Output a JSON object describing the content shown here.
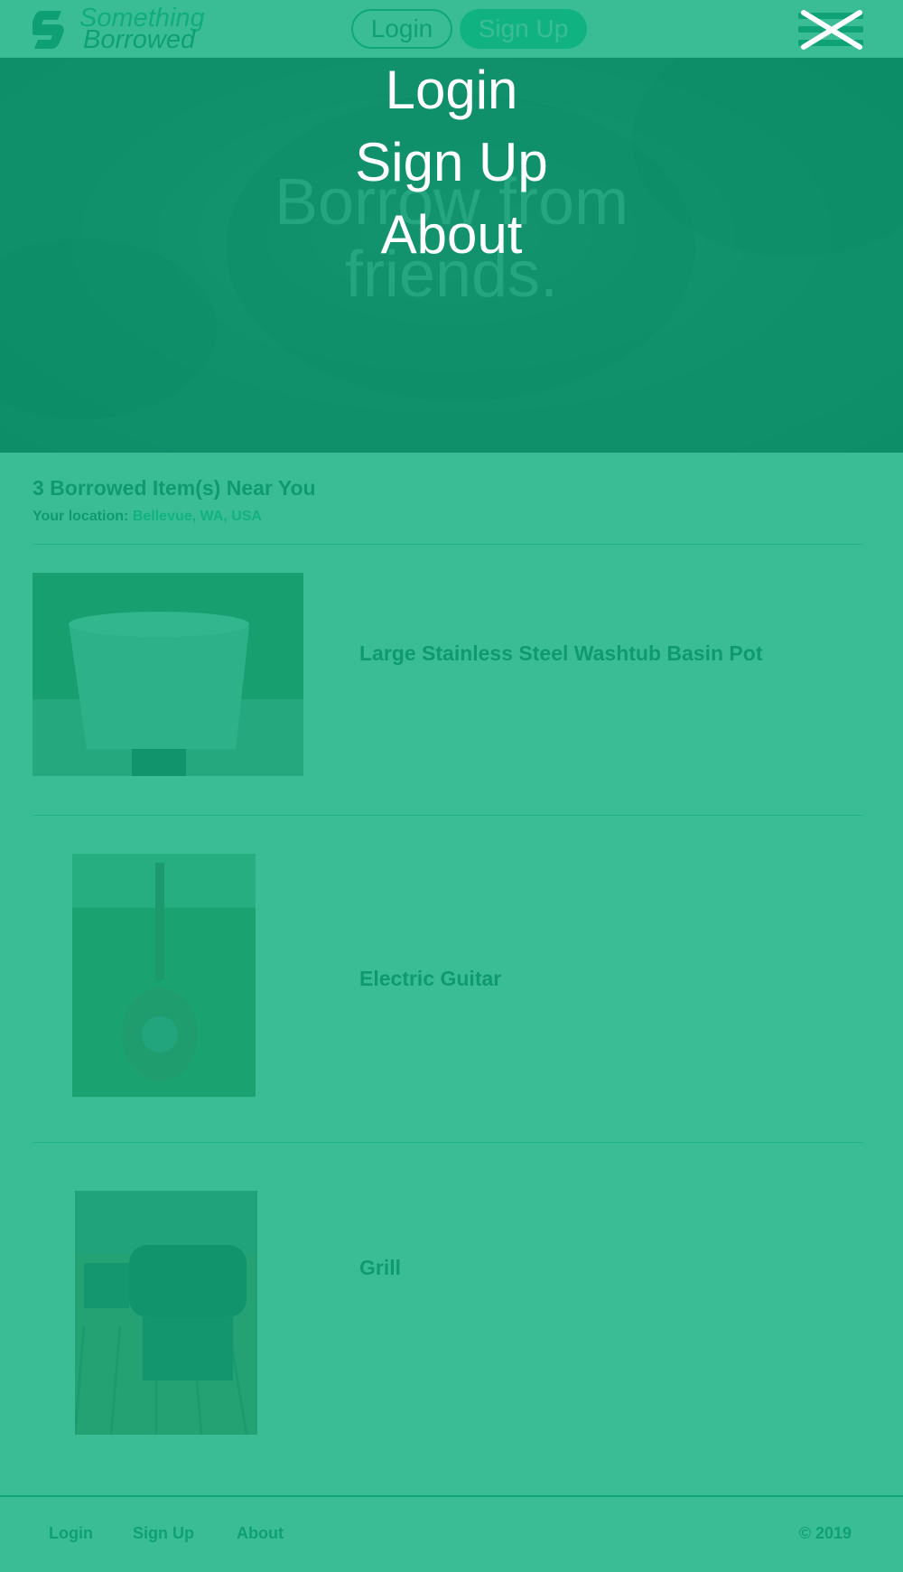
{
  "brand": {
    "line1": "Something",
    "line2": "Borrowed"
  },
  "header": {
    "login_label": "Login",
    "signup_label": "Sign Up",
    "menu_icon": "hamburger-icon"
  },
  "hero": {
    "headline_line1": "Borrow from",
    "headline_line2": "friends."
  },
  "results": {
    "title": "3 Borrowed Item(s) Near You",
    "location_label": "Your location:",
    "location_value": "Bellevue, WA, USA"
  },
  "items": [
    {
      "title": "Large Stainless Steel Washtub Basin Pot",
      "image_icon": "washtub-photo"
    },
    {
      "title": "Electric Guitar",
      "image_icon": "guitar-photo"
    },
    {
      "title": "Grill",
      "image_icon": "grill-photo"
    }
  ],
  "footer": {
    "links": [
      "Login",
      "Sign Up",
      "About"
    ],
    "copyright": "© 2019"
  },
  "overlay_menu": {
    "items": [
      "Login",
      "Sign Up",
      "About"
    ],
    "close_icon": "close-icon"
  },
  "colors": {
    "overlay": "#0fae7e",
    "accent": "#1fbf8f",
    "dark_green": "#0d5e4a"
  }
}
